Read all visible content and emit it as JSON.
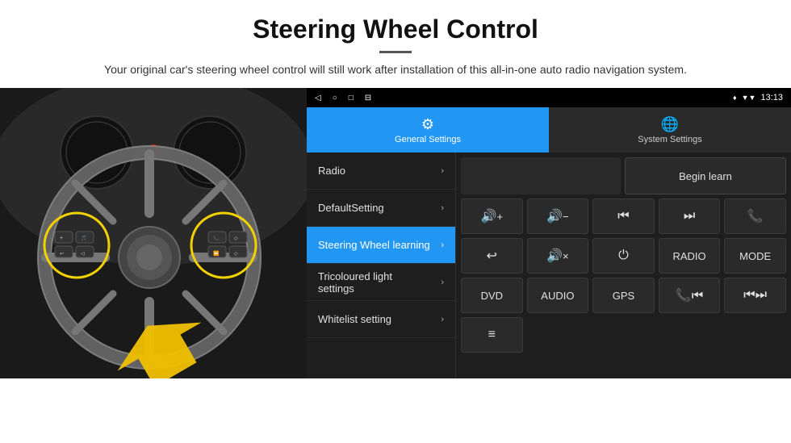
{
  "header": {
    "title": "Steering Wheel Control",
    "description": "Your original car's steering wheel control will still work after installation of this all-in-one auto radio navigation system."
  },
  "status_bar": {
    "time": "13:13",
    "icons": [
      "◁",
      "○",
      "□",
      "⊟"
    ]
  },
  "tabs": [
    {
      "label": "General Settings",
      "active": true
    },
    {
      "label": "System Settings",
      "active": false
    }
  ],
  "menu_items": [
    {
      "label": "Radio",
      "active": false
    },
    {
      "label": "DefaultSetting",
      "active": false
    },
    {
      "label": "Steering Wheel learning",
      "active": true
    },
    {
      "label": "Tricoloured light settings",
      "active": false
    },
    {
      "label": "Whitelist setting",
      "active": false
    }
  ],
  "begin_learn_label": "Begin learn",
  "button_rows": [
    [
      "🔊+",
      "🔊−",
      "⏮",
      "⏭",
      "📞"
    ],
    [
      "↩",
      "🔊×",
      "⏻",
      "RADIO",
      "MODE"
    ],
    [
      "DVD",
      "AUDIO",
      "GPS",
      "📞⏮",
      "⏮⏭"
    ]
  ],
  "bottom_row_icon": "≡"
}
